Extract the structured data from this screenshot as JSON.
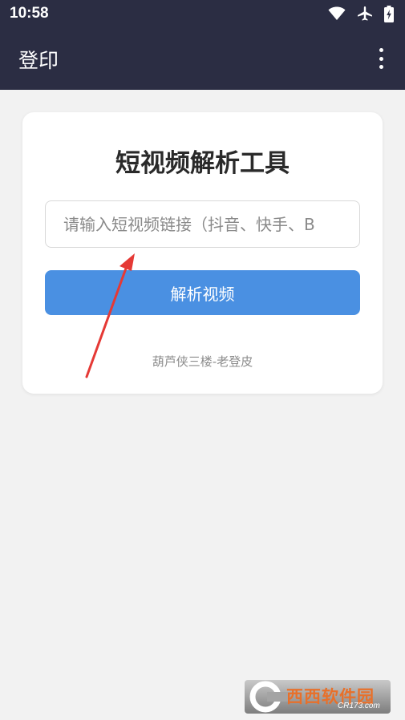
{
  "status_bar": {
    "time": "10:58",
    "icons": [
      "wifi-icon",
      "airplane-icon",
      "battery-charging-icon"
    ]
  },
  "toolbar": {
    "title": "登印",
    "menu_icon": "more-vert-icon"
  },
  "card": {
    "title": "短视频解析工具",
    "input_placeholder": "请输入短视频链接（抖音、快手、B",
    "input_value": "",
    "button_label": "解析视频",
    "credit": "葫芦侠三楼-老登皮"
  },
  "watermark": {
    "brand": "西西软件园",
    "url": "CR173.com"
  },
  "colors": {
    "app_bar": "#2b2d43",
    "page_background": "#f2f2f2",
    "button": "#4a90e2",
    "annotation_arrow": "#e53935"
  }
}
